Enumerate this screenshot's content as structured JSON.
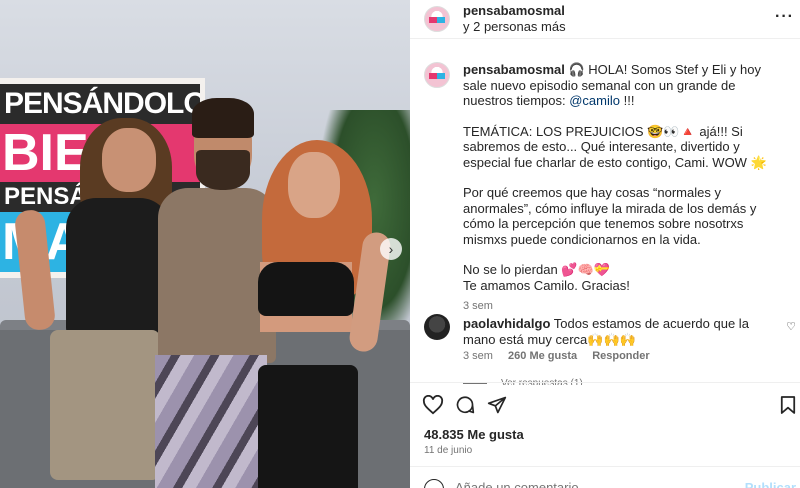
{
  "photo": {
    "sign_line1": "PENSÁNDOLO",
    "sign_line2": "BIEN",
    "sign_line3": "PENSÁNDO",
    "sign_line4": "MAL",
    "next_icon": "chevron-right-icon"
  },
  "header": {
    "username": "pensabamosmal",
    "subtitle": "y 2 personas más",
    "more_icon": "more-horizontal-icon"
  },
  "caption": {
    "username": "pensabamosmal",
    "line1_prefix": "🎧 HOLA! Somos Stef y Eli y hoy sale nuevo episodio semanal con un grande de nuestros tiempos: ",
    "mention": "@camilo",
    "line1_suffix": " !!!",
    "para2": "TEMÁTICA: LOS PREJUICIOS 🤓👀🔺 ajá!!! Si sabremos de esto... Qué interesante, divertido y especial fue charlar de esto contigo, Cami. WOW 🌟",
    "para3": "Por qué creemos que hay cosas “normales y anormales”, cómo influye la mirada de los demás y cómo la percepción que tenemos sobre nosotrxs mismxs puede condicionarnos en la vida.",
    "para4a": "No se lo pierdan 💕🧠💝",
    "para4b": "Te amamos Camilo. Gracias!",
    "time": "3 sem"
  },
  "comment": {
    "username": "paolavhidalgo",
    "text": "Todos estamos de acuerdo que la mano está muy cerca🙌🙌🙌",
    "time": "3 sem",
    "likes": "260 Me gusta",
    "reply": "Responder",
    "view_replies": "Ver respuestas (1)"
  },
  "actions": {
    "like_icon": "heart-icon",
    "comment_icon": "comment-icon",
    "share_icon": "send-icon",
    "save_icon": "bookmark-icon"
  },
  "likes": "48.835 Me gusta",
  "date": "11 de junio",
  "add_comment": {
    "placeholder": "Añade un comentario...",
    "publish": "Publicar"
  }
}
